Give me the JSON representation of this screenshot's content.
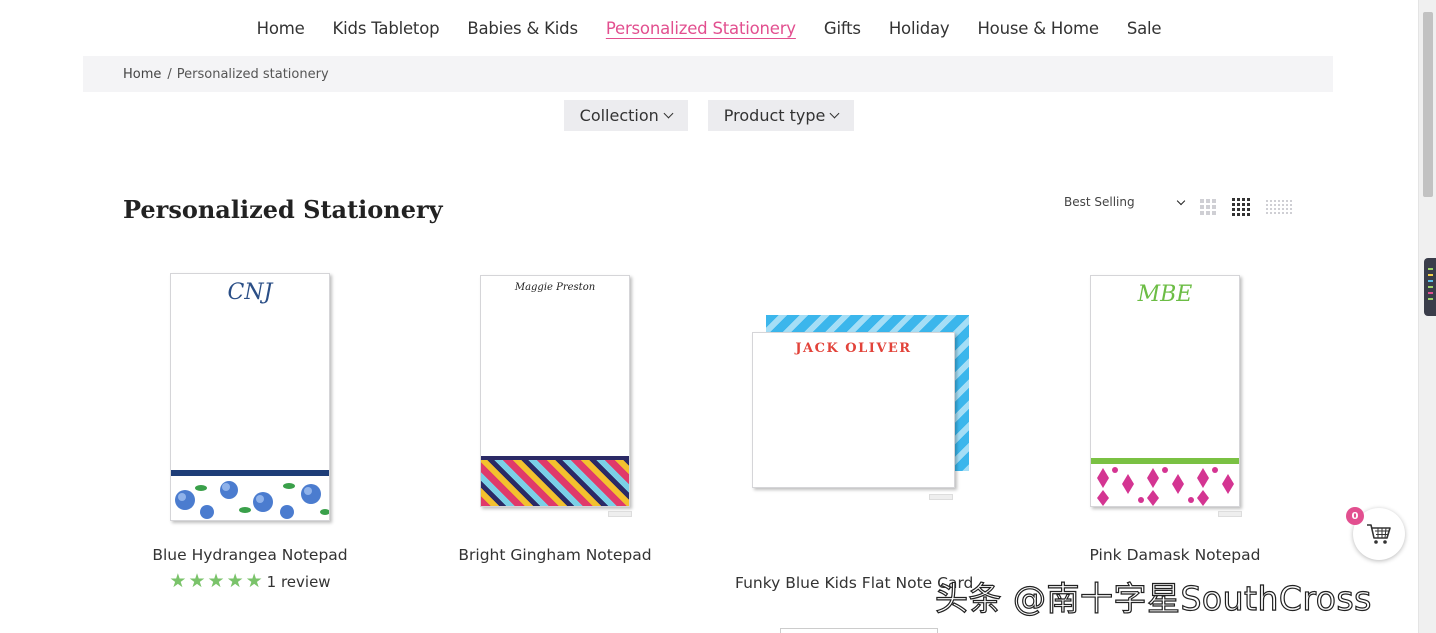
{
  "nav": {
    "items": [
      {
        "label": "Home",
        "active": false
      },
      {
        "label": "Kids Tabletop",
        "active": false
      },
      {
        "label": "Babies & Kids",
        "active": false
      },
      {
        "label": "Personalized Stationery",
        "active": true
      },
      {
        "label": "Gifts",
        "active": false
      },
      {
        "label": "Holiday",
        "active": false
      },
      {
        "label": "House & Home",
        "active": false
      },
      {
        "label": "Sale",
        "active": false
      }
    ],
    "active_color": "#e24f8f"
  },
  "breadcrumb": {
    "home": "Home",
    "separator": "/",
    "current": "Personalized stationery"
  },
  "filters": {
    "collection": "Collection",
    "product_type": "Product type"
  },
  "page": {
    "title": "Personalized Stationery"
  },
  "sort": {
    "selected": "Best Selling"
  },
  "view_options": [
    "grid-3-icon",
    "grid-4-icon",
    "grid-6-icon"
  ],
  "products": [
    {
      "name": "Blue Hydrangea Notepad",
      "monogram": "CNJ",
      "rating": 5,
      "review_text": "1 review"
    },
    {
      "name": "Bright Gingham Notepad",
      "monogram": "Maggie Preston"
    },
    {
      "name": "Funky Blue Kids Flat Note Card",
      "monogram": "JACK OLIVER"
    },
    {
      "name": "Pink Damask Notepad",
      "monogram": "MBE"
    }
  ],
  "cart": {
    "count": "0"
  },
  "watermark": "头条 @南十字星SouthCross",
  "colors": {
    "accent": "#e24f8f",
    "star": "#7ac36a",
    "filter_bg": "#ececef",
    "breadcrumb_bg": "#f4f4f6"
  }
}
